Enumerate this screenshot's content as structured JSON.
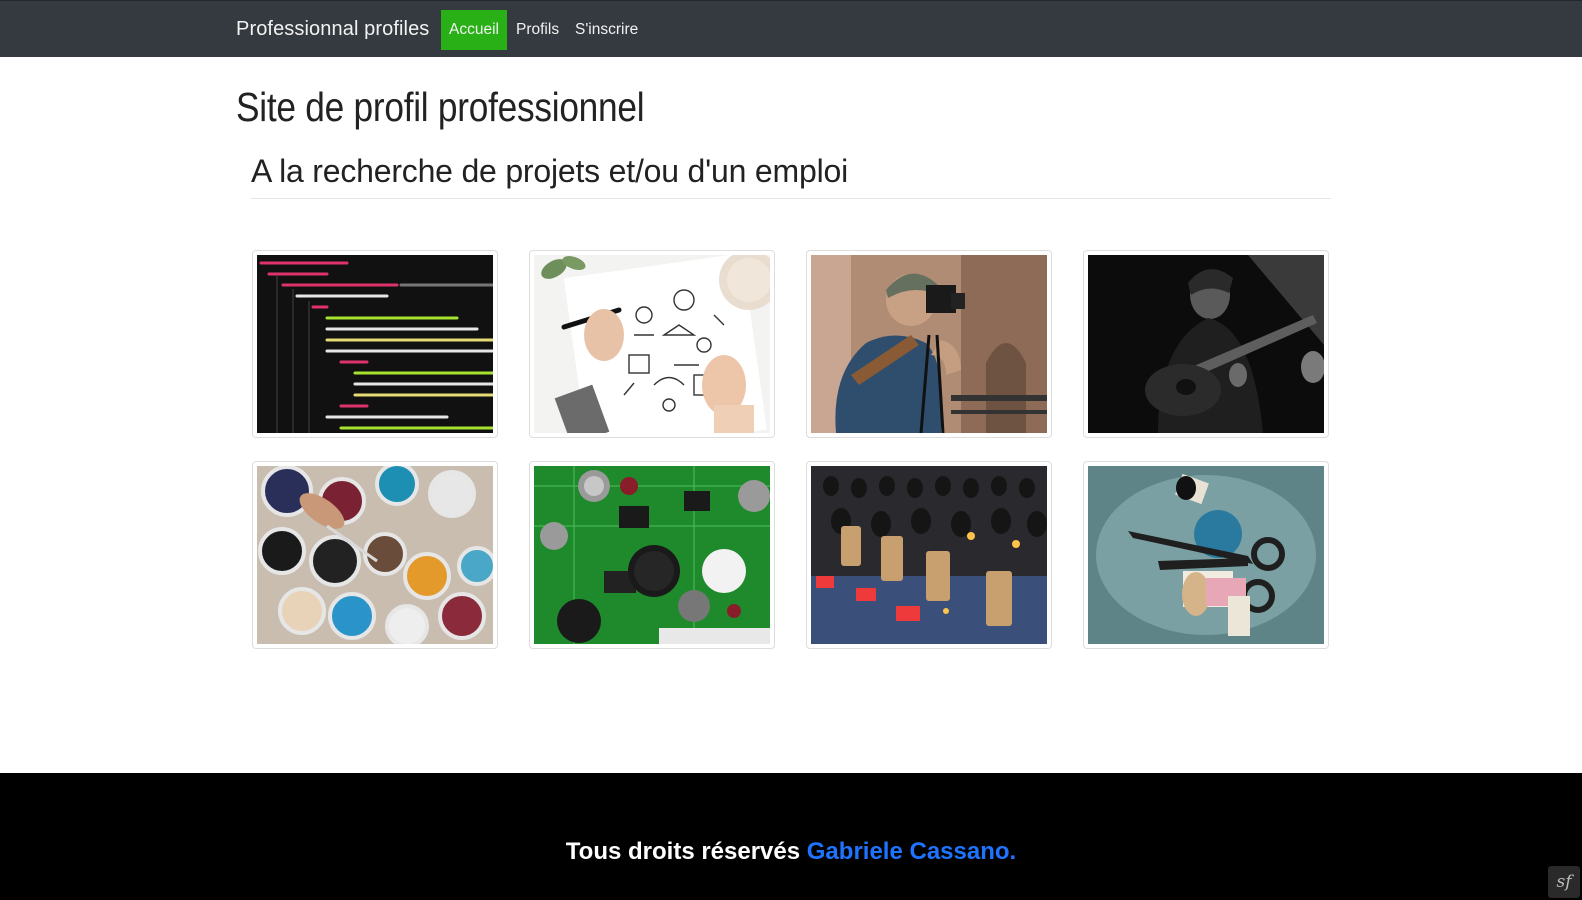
{
  "navbar": {
    "brand": "Professionnal profiles",
    "items": [
      {
        "label": "Accueil",
        "active": true
      },
      {
        "label": "Profils",
        "active": false
      },
      {
        "label": "S'inscrire",
        "active": false
      }
    ]
  },
  "page": {
    "title": "Site de profil professionnel",
    "subtitle": "A la recherche de projets et/ou d'un emploi"
  },
  "gallery": [
    {
      "subject": "code-editor",
      "icon": "code-image"
    },
    {
      "subject": "design-sketches",
      "icon": "drawing-image"
    },
    {
      "subject": "photographer",
      "icon": "camera-image"
    },
    {
      "subject": "guitarist",
      "icon": "guitar-image"
    },
    {
      "subject": "paint-pots",
      "icon": "paint-image"
    },
    {
      "subject": "circuit-board",
      "icon": "circuit-image"
    },
    {
      "subject": "mixing-console",
      "icon": "audio-mixer-image"
    },
    {
      "subject": "sewing-tools",
      "icon": "sewing-image"
    }
  ],
  "footer": {
    "text": "Tous droits réservés ",
    "author": "Gabriele Cassano.",
    "badge": "sf"
  },
  "colors": {
    "navbar_bg": "#343a40",
    "active_nav": "#28b016",
    "footer_bg": "#000000",
    "link": "#1e73ff"
  }
}
